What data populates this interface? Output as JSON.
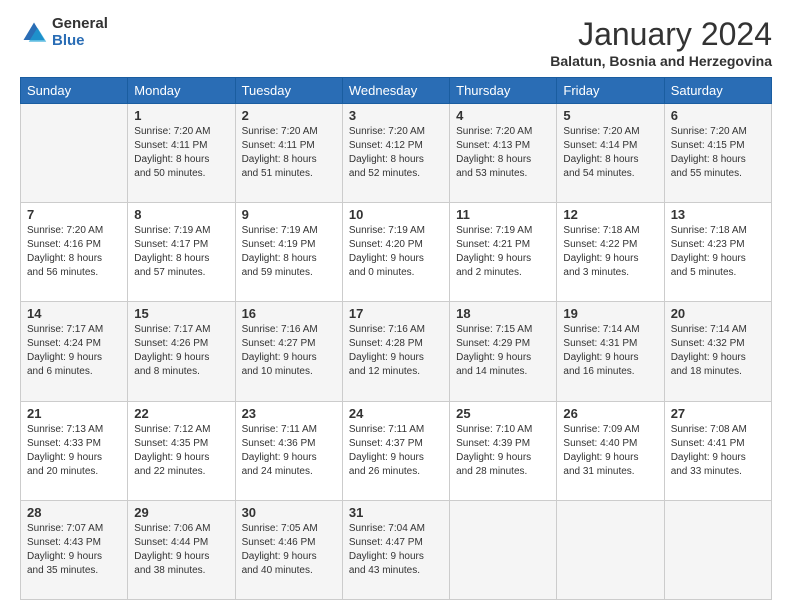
{
  "header": {
    "logo_general": "General",
    "logo_blue": "Blue",
    "month_title": "January 2024",
    "location": "Balatun, Bosnia and Herzegovina"
  },
  "days_of_week": [
    "Sunday",
    "Monday",
    "Tuesday",
    "Wednesday",
    "Thursday",
    "Friday",
    "Saturday"
  ],
  "weeks": [
    [
      {
        "day": "",
        "info": ""
      },
      {
        "day": "1",
        "info": "Sunrise: 7:20 AM\nSunset: 4:11 PM\nDaylight: 8 hours\nand 50 minutes."
      },
      {
        "day": "2",
        "info": "Sunrise: 7:20 AM\nSunset: 4:11 PM\nDaylight: 8 hours\nand 51 minutes."
      },
      {
        "day": "3",
        "info": "Sunrise: 7:20 AM\nSunset: 4:12 PM\nDaylight: 8 hours\nand 52 minutes."
      },
      {
        "day": "4",
        "info": "Sunrise: 7:20 AM\nSunset: 4:13 PM\nDaylight: 8 hours\nand 53 minutes."
      },
      {
        "day": "5",
        "info": "Sunrise: 7:20 AM\nSunset: 4:14 PM\nDaylight: 8 hours\nand 54 minutes."
      },
      {
        "day": "6",
        "info": "Sunrise: 7:20 AM\nSunset: 4:15 PM\nDaylight: 8 hours\nand 55 minutes."
      }
    ],
    [
      {
        "day": "7",
        "info": "Sunrise: 7:20 AM\nSunset: 4:16 PM\nDaylight: 8 hours\nand 56 minutes."
      },
      {
        "day": "8",
        "info": "Sunrise: 7:19 AM\nSunset: 4:17 PM\nDaylight: 8 hours\nand 57 minutes."
      },
      {
        "day": "9",
        "info": "Sunrise: 7:19 AM\nSunset: 4:19 PM\nDaylight: 8 hours\nand 59 minutes."
      },
      {
        "day": "10",
        "info": "Sunrise: 7:19 AM\nSunset: 4:20 PM\nDaylight: 9 hours\nand 0 minutes."
      },
      {
        "day": "11",
        "info": "Sunrise: 7:19 AM\nSunset: 4:21 PM\nDaylight: 9 hours\nand 2 minutes."
      },
      {
        "day": "12",
        "info": "Sunrise: 7:18 AM\nSunset: 4:22 PM\nDaylight: 9 hours\nand 3 minutes."
      },
      {
        "day": "13",
        "info": "Sunrise: 7:18 AM\nSunset: 4:23 PM\nDaylight: 9 hours\nand 5 minutes."
      }
    ],
    [
      {
        "day": "14",
        "info": "Sunrise: 7:17 AM\nSunset: 4:24 PM\nDaylight: 9 hours\nand 6 minutes."
      },
      {
        "day": "15",
        "info": "Sunrise: 7:17 AM\nSunset: 4:26 PM\nDaylight: 9 hours\nand 8 minutes."
      },
      {
        "day": "16",
        "info": "Sunrise: 7:16 AM\nSunset: 4:27 PM\nDaylight: 9 hours\nand 10 minutes."
      },
      {
        "day": "17",
        "info": "Sunrise: 7:16 AM\nSunset: 4:28 PM\nDaylight: 9 hours\nand 12 minutes."
      },
      {
        "day": "18",
        "info": "Sunrise: 7:15 AM\nSunset: 4:29 PM\nDaylight: 9 hours\nand 14 minutes."
      },
      {
        "day": "19",
        "info": "Sunrise: 7:14 AM\nSunset: 4:31 PM\nDaylight: 9 hours\nand 16 minutes."
      },
      {
        "day": "20",
        "info": "Sunrise: 7:14 AM\nSunset: 4:32 PM\nDaylight: 9 hours\nand 18 minutes."
      }
    ],
    [
      {
        "day": "21",
        "info": "Sunrise: 7:13 AM\nSunset: 4:33 PM\nDaylight: 9 hours\nand 20 minutes."
      },
      {
        "day": "22",
        "info": "Sunrise: 7:12 AM\nSunset: 4:35 PM\nDaylight: 9 hours\nand 22 minutes."
      },
      {
        "day": "23",
        "info": "Sunrise: 7:11 AM\nSunset: 4:36 PM\nDaylight: 9 hours\nand 24 minutes."
      },
      {
        "day": "24",
        "info": "Sunrise: 7:11 AM\nSunset: 4:37 PM\nDaylight: 9 hours\nand 26 minutes."
      },
      {
        "day": "25",
        "info": "Sunrise: 7:10 AM\nSunset: 4:39 PM\nDaylight: 9 hours\nand 28 minutes."
      },
      {
        "day": "26",
        "info": "Sunrise: 7:09 AM\nSunset: 4:40 PM\nDaylight: 9 hours\nand 31 minutes."
      },
      {
        "day": "27",
        "info": "Sunrise: 7:08 AM\nSunset: 4:41 PM\nDaylight: 9 hours\nand 33 minutes."
      }
    ],
    [
      {
        "day": "28",
        "info": "Sunrise: 7:07 AM\nSunset: 4:43 PM\nDaylight: 9 hours\nand 35 minutes."
      },
      {
        "day": "29",
        "info": "Sunrise: 7:06 AM\nSunset: 4:44 PM\nDaylight: 9 hours\nand 38 minutes."
      },
      {
        "day": "30",
        "info": "Sunrise: 7:05 AM\nSunset: 4:46 PM\nDaylight: 9 hours\nand 40 minutes."
      },
      {
        "day": "31",
        "info": "Sunrise: 7:04 AM\nSunset: 4:47 PM\nDaylight: 9 hours\nand 43 minutes."
      },
      {
        "day": "",
        "info": ""
      },
      {
        "day": "",
        "info": ""
      },
      {
        "day": "",
        "info": ""
      }
    ]
  ]
}
